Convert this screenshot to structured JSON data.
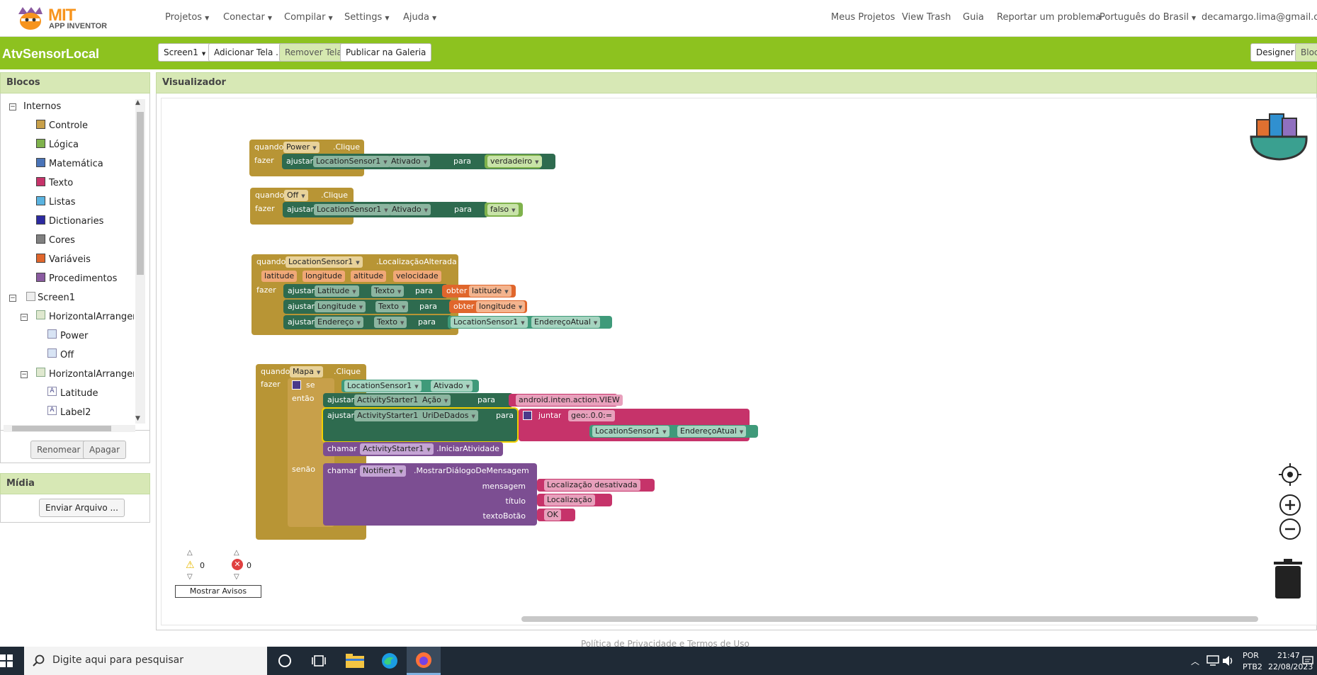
{
  "brand": {
    "line1": "MIT",
    "line2": "APP INVENTOR"
  },
  "nav": {
    "menus": [
      "Projetos",
      "Conectar",
      "Compilar",
      "Settings",
      "Ajuda"
    ],
    "right_links": [
      "Meus Projetos",
      "View Trash",
      "Guia",
      "Reportar um problema"
    ],
    "language": "Português do Brasil",
    "account": "decamargo.lima@gmail.com"
  },
  "toolbar": {
    "project_name": "AtvSensorLocal",
    "screen": "Screen1",
    "add_screen": "Adicionar Tela ...",
    "remove_screen": "Remover Tela",
    "publish": "Publicar na Galeria",
    "designer": "Designer",
    "blocks": "Bloc"
  },
  "blocks_panel": {
    "title": "Blocos",
    "builtin_label": "Internos",
    "builtin": [
      {
        "label": "Controle",
        "color": "#c8a04a"
      },
      {
        "label": "Lógica",
        "color": "#7fb24c"
      },
      {
        "label": "Matemática",
        "color": "#4a74b8"
      },
      {
        "label": "Texto",
        "color": "#c6336a"
      },
      {
        "label": "Listas",
        "color": "#5ab3e0"
      },
      {
        "label": "Dictionaries",
        "color": "#2c2aa0"
      },
      {
        "label": "Cores",
        "color": "#808080"
      },
      {
        "label": "Variáveis",
        "color": "#e0662c"
      },
      {
        "label": "Procedimentos",
        "color": "#8a5aa0"
      }
    ],
    "screen_label": "Screen1",
    "components": [
      {
        "label": "HorizontalArrangemen",
        "level": 1
      },
      {
        "label": "Power",
        "level": 2
      },
      {
        "label": "Off",
        "level": 2
      },
      {
        "label": "HorizontalArrangemen",
        "level": 1
      },
      {
        "label": "Latitude",
        "level": 2
      },
      {
        "label": "Label2",
        "level": 2
      }
    ],
    "rename": "Renomear",
    "delete": "Apagar"
  },
  "media_panel": {
    "title": "Mídia",
    "upload": "Enviar Arquivo ..."
  },
  "viewer": {
    "title": "Visualizador",
    "warnings_count": "0",
    "errors_count": "0",
    "show_warnings": "Mostrar Avisos"
  },
  "blocks_ws": {
    "when": "quando",
    "do": "fazer",
    "set": "ajustar",
    "to": "para",
    "get": "obter",
    "call": "chamar",
    "if": "se",
    "then": "então",
    "else": "senão",
    "join": "juntar",
    "b1": {
      "component": "Power",
      "event": ".Clique",
      "target": "LocationSensor1",
      "prop": "Ativado",
      "value": "verdadeiro"
    },
    "b2": {
      "component": "Off",
      "event": ".Clique",
      "target": "LocationSensor1",
      "prop": "Ativado",
      "value": "falso"
    },
    "b3": {
      "component": "LocationSensor1",
      "event": ".LocalizaçãoAlterada",
      "params": [
        "latitude",
        "longitude",
        "altitude",
        "velocidade"
      ],
      "r1": {
        "target": "Latitude",
        "prop": "Texto",
        "var": "latitude"
      },
      "r2": {
        "target": "Longitude",
        "prop": "Texto",
        "var": "longitude"
      },
      "r3": {
        "target": "Endereço",
        "prop": "Texto",
        "src": "LocationSensor1",
        "src_prop": "EndereçoAtual"
      }
    },
    "b4": {
      "component": "Mapa",
      "event": ".Clique",
      "cond_comp": "LocationSensor1",
      "cond_prop": "Ativado",
      "act": "ActivityStarter1",
      "action_prop": "Ação",
      "action_val": "android.inten.action.VIEW",
      "uri_prop": "UriDeDados",
      "geo": "geo:.0.0:=",
      "loc_comp": "LocationSensor1",
      "loc_prop": "EndereçoAtual",
      "start": ".IniciarAtividade",
      "notifier": "Notifier1",
      "method": ".MostrarDiálogoDeMensagem",
      "msg_label": "mensagem",
      "msg_val": "Localização desativada",
      "title_label": "título",
      "title_val": "Localização",
      "btn_label": "textoBotão",
      "btn_val": "OK"
    }
  },
  "footer": "Política de Privacidade e Termos de Uso",
  "taskbar": {
    "search_placeholder": "Digite aqui para pesquisar",
    "lang1": "POR",
    "lang2": "PTB2",
    "time": "21:47",
    "date": "22/08/2023"
  }
}
